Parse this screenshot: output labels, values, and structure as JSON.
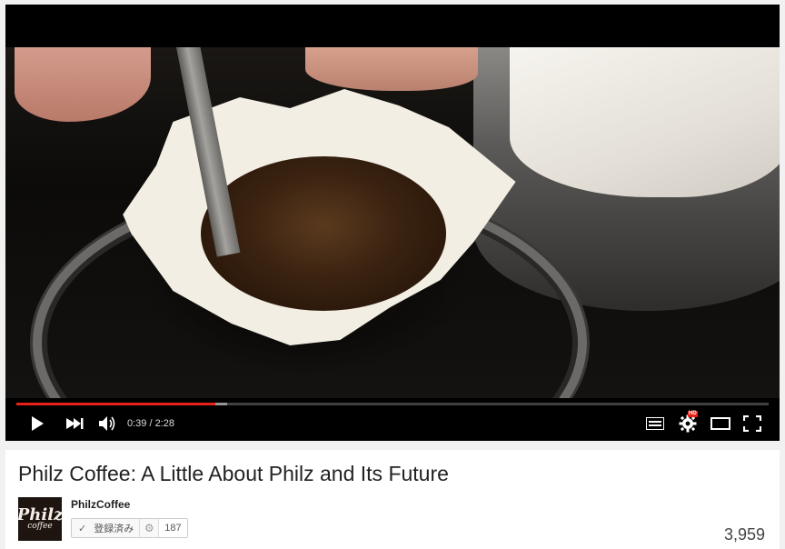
{
  "player": {
    "progress_fraction": 0.265,
    "buffer_fraction": 0.28,
    "progress_color": "#e62117",
    "time_text": "0:39 / 2:28",
    "hd_badge": "HD",
    "controls": {
      "play_icon": "play-icon",
      "next_icon": "next-icon",
      "volume_icon": "volume-icon",
      "captions_icon": "captions-icon",
      "settings_icon": "gear-icon",
      "theater_icon": "theater-mode-icon",
      "fullscreen_icon": "fullscreen-icon"
    }
  },
  "video": {
    "title": "Philz Coffee: A Little About Philz and Its Future"
  },
  "channel": {
    "name": "PhilzCoffee",
    "avatar_text_top": "Philz",
    "avatar_text_bottom": "coffee",
    "subscribe_label": "登録済み",
    "subscriber_count": "187"
  },
  "stats": {
    "views": "3,959"
  }
}
